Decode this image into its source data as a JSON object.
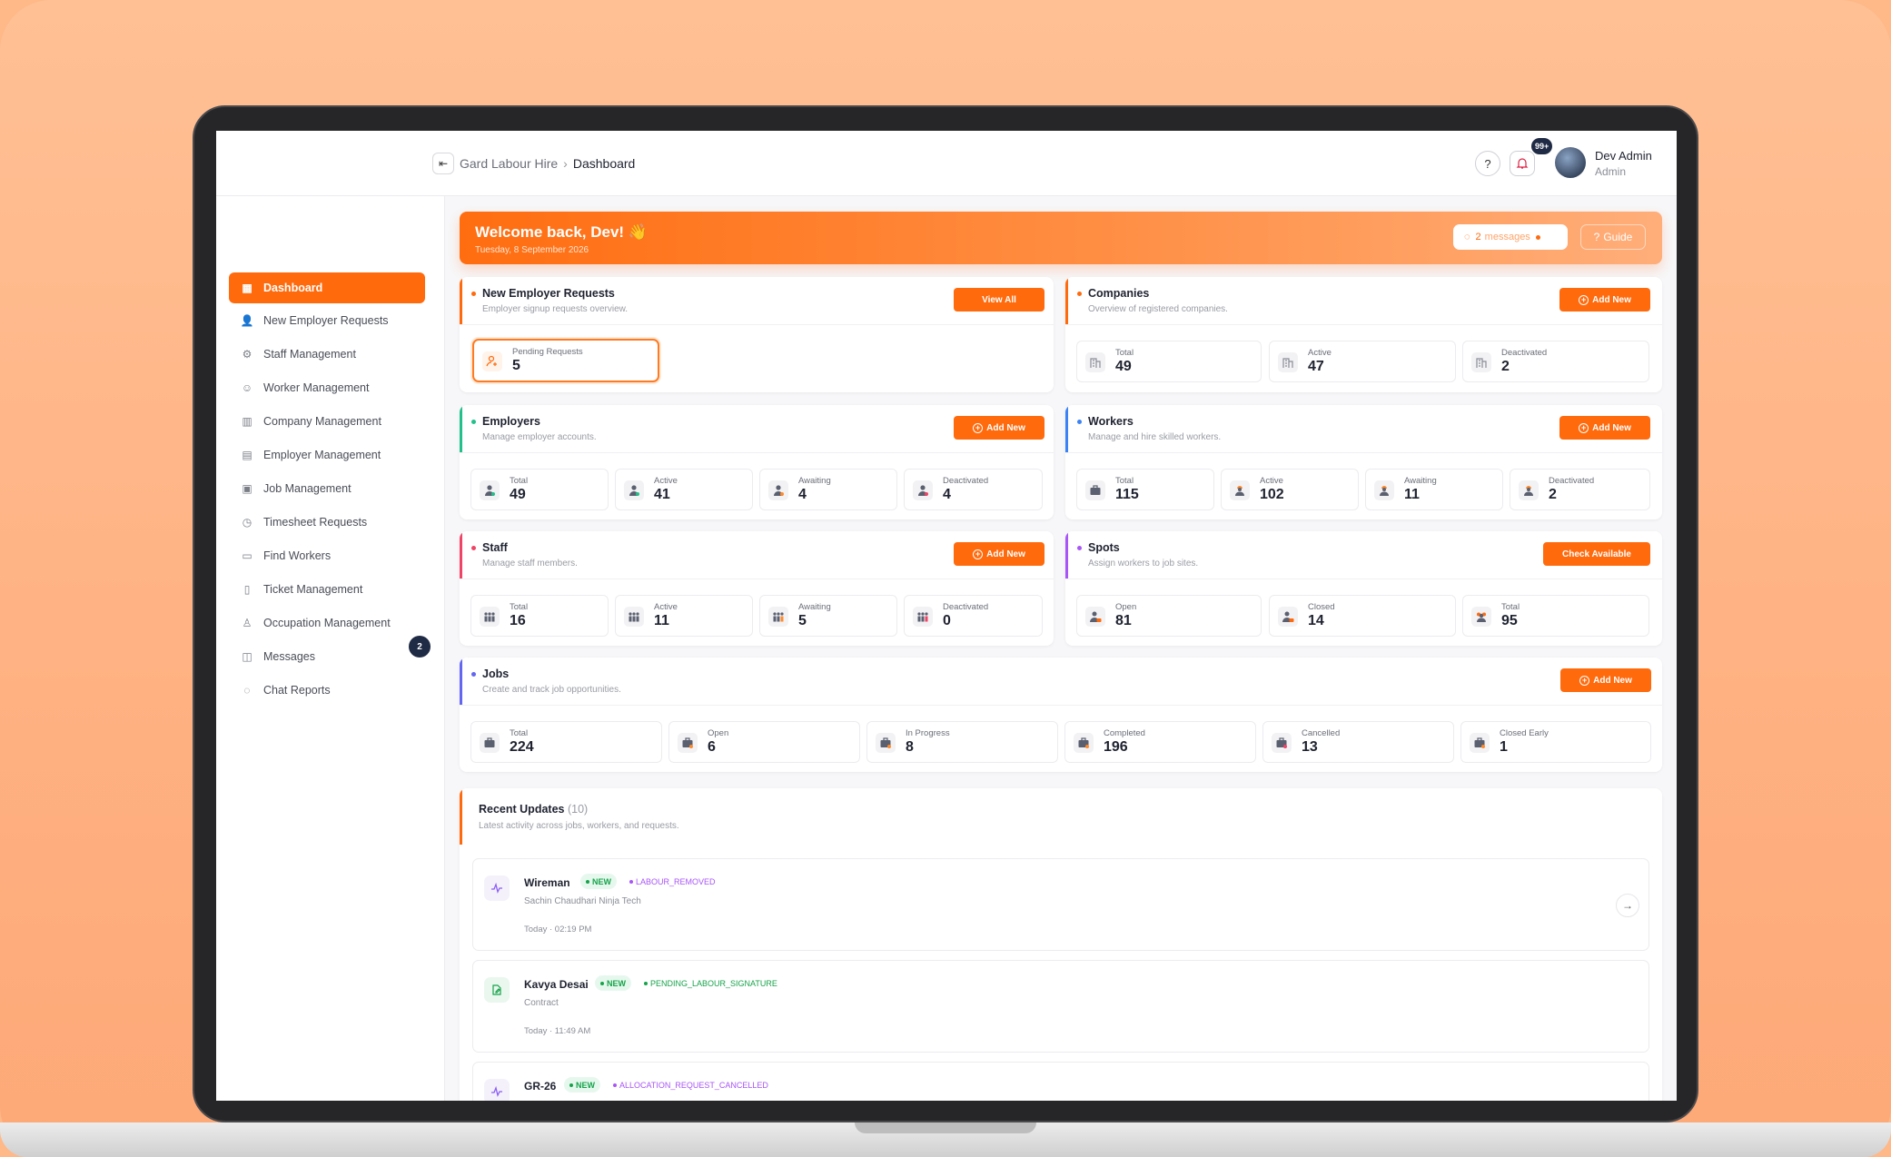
{
  "breadcrumb": {
    "root": "Gard Labour Hire",
    "current": "Dashboard"
  },
  "header": {
    "notif_count": "99+",
    "user_name": "Dev Admin",
    "user_role": "Admin"
  },
  "sidebar": {
    "items": [
      {
        "label": "Dashboard",
        "icon": "grid-icon"
      },
      {
        "label": "New Employer Requests",
        "icon": "user-plus-icon"
      },
      {
        "label": "Staff Management",
        "icon": "user-gear-icon"
      },
      {
        "label": "Worker Management",
        "icon": "user-icon"
      },
      {
        "label": "Company Management",
        "icon": "building-icon"
      },
      {
        "label": "Employer Management",
        "icon": "building-user-icon"
      },
      {
        "label": "Job Management",
        "icon": "briefcase-icon"
      },
      {
        "label": "Timesheet Requests",
        "icon": "clock-file-icon"
      },
      {
        "label": "Find Workers",
        "icon": "calendar-icon"
      },
      {
        "label": "Ticket Management",
        "icon": "bookmark-icon"
      },
      {
        "label": "Occupation Management",
        "icon": "user-tie-icon"
      },
      {
        "label": "Messages",
        "icon": "chat-icon"
      },
      {
        "label": "Chat Reports",
        "icon": "chat-alert-icon"
      }
    ],
    "messages_badge": "2"
  },
  "welcome": {
    "title": "Welcome back, Dev! 👋",
    "date": "Tuesday, 8 September 2026",
    "messages_count": "2",
    "messages_label": "messages",
    "guide_label": "Guide"
  },
  "cards": {
    "employer_requests": {
      "title": "New Employer Requests",
      "subtitle": "Employer signup requests overview.",
      "button": "View All",
      "stats": [
        {
          "label": "Pending Requests",
          "value": "5"
        }
      ]
    },
    "companies": {
      "title": "Companies",
      "subtitle": "Overview of registered companies.",
      "button": "Add New",
      "stats": [
        {
          "label": "Total",
          "value": "49"
        },
        {
          "label": "Active",
          "value": "47"
        },
        {
          "label": "Deactivated",
          "value": "2"
        }
      ]
    },
    "employers": {
      "title": "Employers",
      "subtitle": "Manage employer accounts.",
      "button": "Add New",
      "stats": [
        {
          "label": "Total",
          "value": "49"
        },
        {
          "label": "Active",
          "value": "41"
        },
        {
          "label": "Awaiting",
          "value": "4"
        },
        {
          "label": "Deactivated",
          "value": "4"
        }
      ]
    },
    "workers": {
      "title": "Workers",
      "subtitle": "Manage and hire skilled workers.",
      "button": "Add New",
      "stats": [
        {
          "label": "Total",
          "value": "115"
        },
        {
          "label": "Active",
          "value": "102"
        },
        {
          "label": "Awaiting",
          "value": "11"
        },
        {
          "label": "Deactivated",
          "value": "2"
        }
      ]
    },
    "staff": {
      "title": "Staff",
      "subtitle": "Manage staff members.",
      "button": "Add New",
      "stats": [
        {
          "label": "Total",
          "value": "16"
        },
        {
          "label": "Active",
          "value": "11"
        },
        {
          "label": "Awaiting",
          "value": "5"
        },
        {
          "label": "Deactivated",
          "value": "0"
        }
      ]
    },
    "spots": {
      "title": "Spots",
      "subtitle": "Assign workers to job sites.",
      "button": "Check Available",
      "stats": [
        {
          "label": "Open",
          "value": "81"
        },
        {
          "label": "Closed",
          "value": "14"
        },
        {
          "label": "Total",
          "value": "95"
        }
      ]
    },
    "jobs": {
      "title": "Jobs",
      "subtitle": "Create and track job opportunities.",
      "button": "Add New",
      "stats": [
        {
          "label": "Total",
          "value": "224"
        },
        {
          "label": "Open",
          "value": "6"
        },
        {
          "label": "In Progress",
          "value": "8"
        },
        {
          "label": "Completed",
          "value": "196"
        },
        {
          "label": "Cancelled",
          "value": "13"
        },
        {
          "label": "Closed Early",
          "value": "1"
        }
      ]
    }
  },
  "recent": {
    "title": "Recent Updates",
    "count": "(10)",
    "subtitle": "Latest activity across jobs, workers, and requests.",
    "items": [
      {
        "name": "Wireman",
        "badge": "NEW",
        "status": "LABOUR_REMOVED",
        "sub": "Sachin Chaudhari Ninja Tech",
        "time": "Today · 02:19 PM"
      },
      {
        "name": "Kavya Desai",
        "badge": "NEW",
        "status": "PENDING_LABOUR_SIGNATURE",
        "sub": "Contract",
        "time": "Today · 11:49 AM"
      },
      {
        "name": "GR-26",
        "badge": "NEW",
        "status": "ALLOCATION_REQUEST_CANCELLED",
        "sub": "",
        "time": ""
      }
    ]
  },
  "colors": {
    "accent": "#ff6a0d",
    "employers": "#22c08a",
    "workers": "#3b82f6",
    "staff": "#ef4466",
    "spots": "#a855f7",
    "jobs": "#6366f1"
  }
}
